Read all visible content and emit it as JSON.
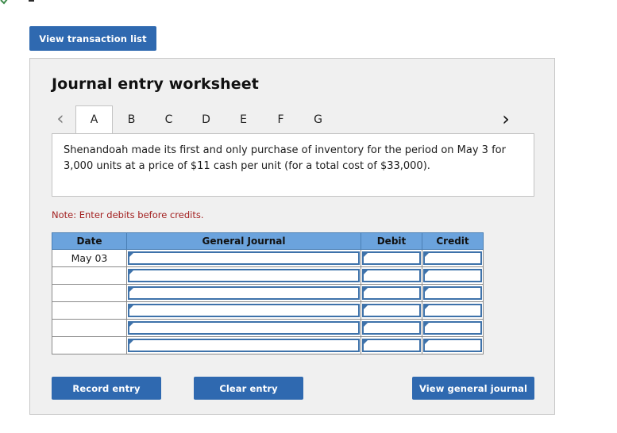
{
  "top": {
    "view_transaction_list_label": "View transaction list"
  },
  "panel": {
    "title": "Journal entry worksheet",
    "tabs": [
      {
        "label": "A",
        "active": true
      },
      {
        "label": "B",
        "active": false
      },
      {
        "label": "C",
        "active": false
      },
      {
        "label": "D",
        "active": false
      },
      {
        "label": "E",
        "active": false
      },
      {
        "label": "F",
        "active": false
      },
      {
        "label": "G",
        "active": false
      }
    ],
    "prev_arrow": "‹",
    "next_arrow": "›",
    "description": "Shenandoah made its first and only purchase of inventory for the period on May 3 for 3,000 units at a price of $11 cash per unit (for a total cost of $33,000).",
    "note": "Note: Enter debits before credits."
  },
  "table": {
    "headers": [
      "Date",
      "General Journal",
      "Debit",
      "Credit"
    ],
    "rows": [
      {
        "date": "May 03",
        "general_journal": "",
        "debit": "",
        "credit": ""
      },
      {
        "date": "",
        "general_journal": "",
        "debit": "",
        "credit": ""
      },
      {
        "date": "",
        "general_journal": "",
        "debit": "",
        "credit": ""
      },
      {
        "date": "",
        "general_journal": "",
        "debit": "",
        "credit": ""
      },
      {
        "date": "",
        "general_journal": "",
        "debit": "",
        "credit": ""
      },
      {
        "date": "",
        "general_journal": "",
        "debit": "",
        "credit": ""
      }
    ]
  },
  "actions": {
    "record_entry_label": "Record entry",
    "clear_entry_label": "Clear entry",
    "view_general_journal_label": "View general journal"
  },
  "colors": {
    "button_blue": "#2f69b0",
    "table_header_blue": "#6ba3dd",
    "input_border_blue": "#3e72aa",
    "note_red": "#a32020",
    "panel_bg": "#f0f0f0"
  }
}
